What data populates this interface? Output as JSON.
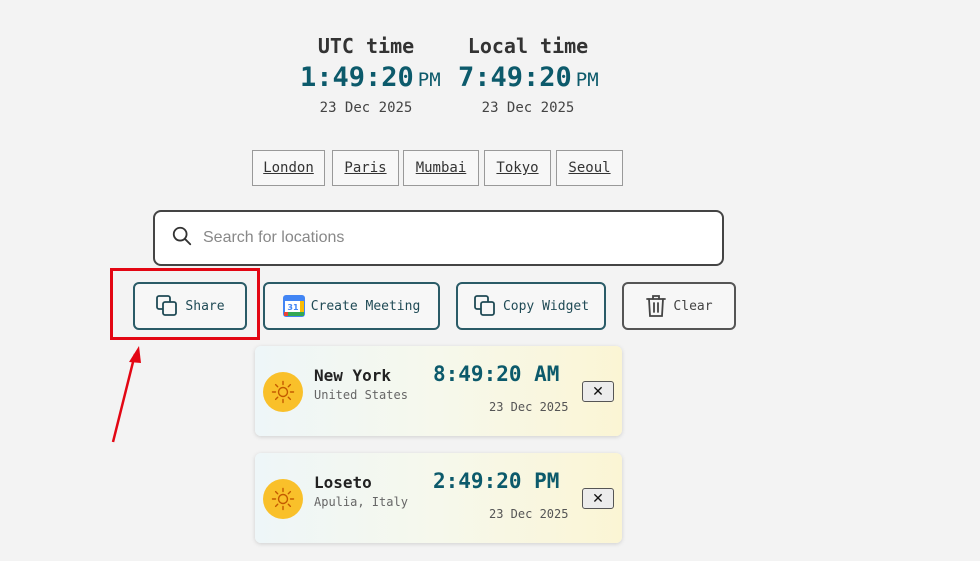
{
  "utc": {
    "title": "UTC time",
    "time": "1:49:20",
    "ampm": "PM",
    "date": "23 Dec 2025"
  },
  "local": {
    "title": "Local time",
    "time": "7:49:20",
    "ampm": "PM",
    "date": "23 Dec 2025"
  },
  "cities": [
    {
      "label": "London"
    },
    {
      "label": "Paris"
    },
    {
      "label": "Mumbai"
    },
    {
      "label": "Tokyo"
    },
    {
      "label": "Seoul"
    }
  ],
  "search": {
    "placeholder": "Search for locations",
    "value": ""
  },
  "actions": {
    "share_label": "Share",
    "meeting_label": "Create Meeting",
    "meeting_icon_text": "31",
    "widget_label": "Copy Widget",
    "clear_label": "Clear"
  },
  "locations": [
    {
      "city": "New York",
      "region": "United States",
      "time": "8:49:20 AM",
      "date": "23 Dec 2025",
      "remove": "✕"
    },
    {
      "city": "Loseto",
      "region": "Apulia, Italy",
      "time": "2:49:20 PM",
      "date": "23 Dec 2025",
      "remove": "✕"
    }
  ],
  "colors": {
    "accent": "#0c5a6b",
    "highlight": "#e30613",
    "sun": "#f9c02a"
  }
}
